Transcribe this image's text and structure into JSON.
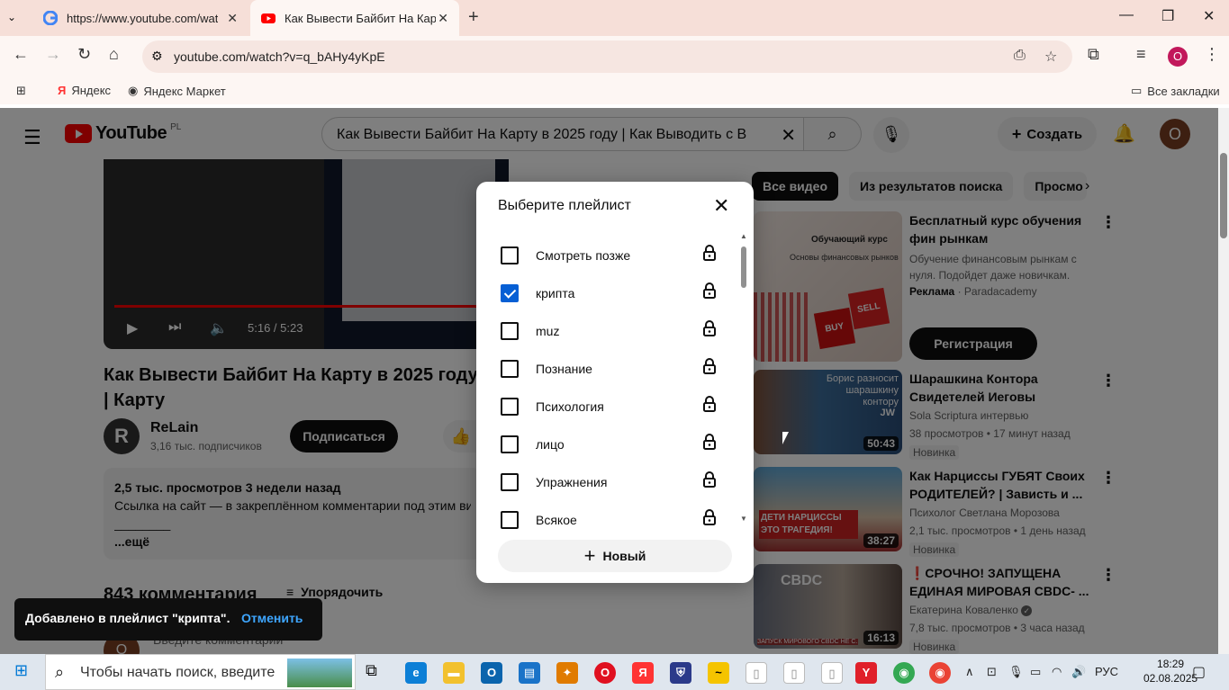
{
  "browser": {
    "tabs": [
      {
        "title": "https://www.youtube.com/watc",
        "active": false
      },
      {
        "title": "Как Вывести Байбит На Карту",
        "active": true
      }
    ],
    "url": "youtube.com/watch?v=q_bAHy4yKpE",
    "bookmarks": [
      "Яндекс",
      "Яндекс Маркет"
    ],
    "all_bookmarks": "Все закладки",
    "profile_initial": "O"
  },
  "youtube": {
    "logo_text": "YouTube",
    "country_code": "PL",
    "search_query": "Как Вывести Байбит На Карту в 2025 году | Как Выводить с В",
    "create_label": "Создать",
    "avatar_initial": "О",
    "player": {
      "time": "5:16 / 5:23",
      "progress": 0.978
    },
    "video_title": "Как Вывести Байбит На Карту в 2025 году | Карту",
    "channel": {
      "initial": "R",
      "name": "ReLain",
      "subs": "3,16 тыс. подписчиков"
    },
    "subscribe_label": "Подписаться",
    "description": {
      "meta": "2,5 тыс. просмотров  3 недели назад",
      "line1": "Ссылка на сайт — в закреплённом комментарии под этим ви",
      "line2": "________",
      "more": "...ещё"
    },
    "comments_count": "843 комментария",
    "sort_label": "Упорядочить",
    "comment_placeholder": "Введите комментарий",
    "chips": [
      "Все видео",
      "Из результатов поиска",
      "Просмо"
    ],
    "ad": {
      "title": "Бесплатный курс обучения фин рынкам",
      "desc": "Обучение финансовым рынкам с нуля. Подойдет даже новичкам.",
      "sponsor_label": "Реклама",
      "sponsor_name": "· Paradacademy",
      "cta": "Регистрация",
      "thumb_heading": "Обучающий курс",
      "thumb_sub": "Основы финансовых рынков",
      "thumb_sell": "SELL",
      "thumb_buy": "BUY"
    },
    "related": [
      {
        "title": "Шарашкина Контора Свидетелей Иеговы",
        "author": "Sola Scriptura интервью",
        "stats": "38 просмотров • 17 минут назад",
        "badge": "Новинка",
        "duration": "50:43",
        "thumb_text": "Борис разносит шарашкину контору",
        "thumb_logo": "JW"
      },
      {
        "title": "Как Нарциссы ГУБЯТ Своих РОДИТЕЛЕЙ? | Зависть и ...",
        "author": "Психолог Светлана Морозова",
        "stats": "2,1 тыс. просмотров • 1 день назад",
        "badge": "Новинка",
        "duration": "38:27",
        "thumb_text": "ДЕТИ НАРЦИССЫ ЭТО ТРАГЕДИЯ!"
      },
      {
        "title": "❗СРОЧНО! ЗАПУЩЕНА ЕДИНАЯ МИРОВАЯ  CBDC- ...",
        "author": "Екатерина Коваленко",
        "stats": "7,8 тыс. просмотров • 3 часа назад",
        "badge": "Новинка",
        "duration": "16:13",
        "thumb_text": "CBDC",
        "thumb_caption": "ЗАПУСК МИРОВОГО CBDC НЕ С..."
      }
    ]
  },
  "dialog": {
    "title": "Выберите плейлист",
    "playlists": [
      {
        "name": "Смотреть позже",
        "checked": false
      },
      {
        "name": "крипта",
        "checked": true
      },
      {
        "name": "muz",
        "checked": false
      },
      {
        "name": "Познание",
        "checked": false
      },
      {
        "name": "Психология",
        "checked": false
      },
      {
        "name": "лицо",
        "checked": false
      },
      {
        "name": "Упражнения",
        "checked": false
      },
      {
        "name": "Всякое",
        "checked": false
      }
    ],
    "new_label": "Новый"
  },
  "toast": {
    "message": "Добавлено в плейлист \"крипта\".",
    "undo": "Отменить"
  },
  "taskbar": {
    "search_placeholder": "Чтобы начать поиск, введите",
    "lang": "РУС",
    "time": "18:29",
    "date": "02.08.2025"
  },
  "colors": {
    "accent": "#065fd4",
    "yt_red": "#ff0000",
    "link": "#3ea6ff"
  }
}
